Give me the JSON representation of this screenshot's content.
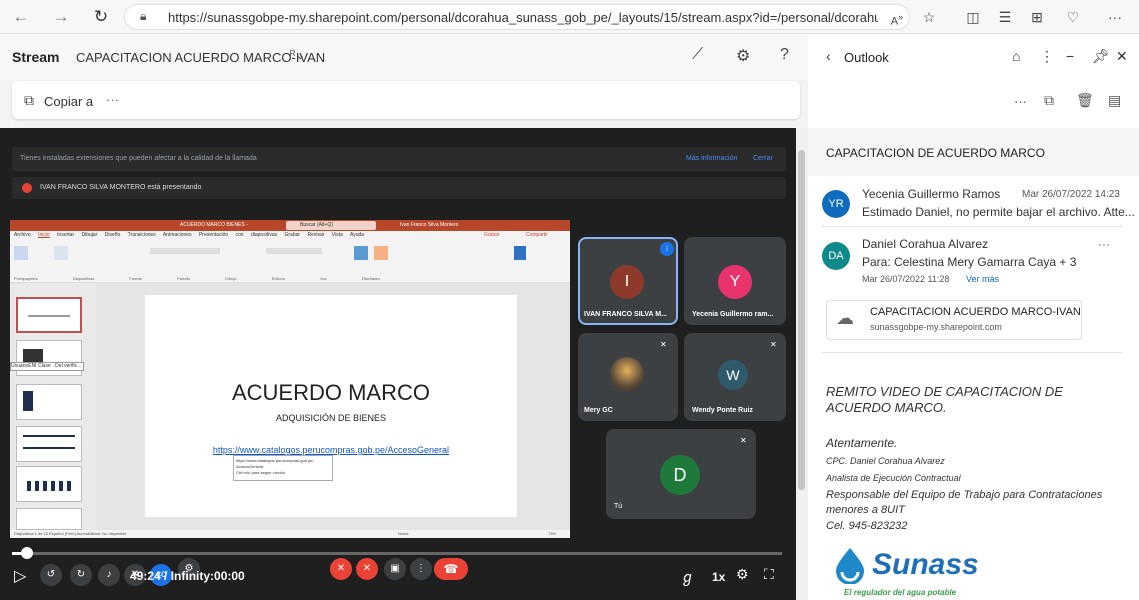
{
  "browser": {
    "url": "https://sunassgobpe-my.sharepoint.com/personal/dcorahua_sunass_gob_pe/_layouts/15/stream.aspx?id=/personal/dcorahua_suna..."
  },
  "stream": {
    "app": "Stream",
    "title": "CAPACITACION ACUERDO MARCO-IVAN",
    "copy_label": "Copiar a",
    "more": "···"
  },
  "meet": {
    "banner1": "Tienes instaladas extensiones que pueden afectar a la calidad de la llamada",
    "banner1_link": "Más información",
    "banner1_close": "Cerrar",
    "banner2": "IVAN FRANCO SILVA MONTERO está presentando",
    "ppt_title": "ACUERDO MARCO BIENES -",
    "ppt_search": "Buscar (Alt+Q)",
    "ppt_user": "Ivan Franco Silva Montero",
    "ppt_tabs": [
      "Archivo",
      "Inicio",
      "Insertar",
      "Dibujar",
      "Diseño",
      "Transiciones",
      "Animaciones",
      "Presentación con diapositivas",
      "Grabar",
      "Revisar",
      "Vista",
      "Ayuda"
    ],
    "ppt_groups": [
      "Portapapeles",
      "Diapositivas",
      "Fuente",
      "Párrafo",
      "Dibujo",
      "Edición",
      "Voz",
      "Diseñador"
    ],
    "ppt_grabar": "Grabar",
    "ppt_compartir": "Compartir",
    "slide_title": "ACUERDO MARCO",
    "slide_subtitle": "ADQUISICIÓN DE BIENES",
    "slide_link": "https://www.catalogos.perucompras.gob.pe/AccesoGeneral",
    "tooltip": [
      "https://www.catalogos.perucompras.gob.pe/",
      "AccesoGeneral",
      "Ctrl+clic para seguir vínculo"
    ],
    "thumb_tip": "UsuarioENI Clase · Del verific...",
    "status_left": "Diapositiva 1 de 12   Español (Perú)   Accesibilidad: No disponible",
    "status_right": "Notas",
    "zoom": "73%",
    "participants": [
      {
        "initial": "I",
        "name": "IVAN FRANCO SILVA M...",
        "color": "#8d3a2b"
      },
      {
        "initial": "Y",
        "name": "Yecenia Guillermo ram...",
        "color": "#e8336d"
      },
      {
        "initial": "",
        "name": "Mery GC",
        "color": "#5a4a3a"
      },
      {
        "initial": "W",
        "name": "Wendy Ponte Ruiz",
        "color": "#2e5a6b"
      },
      {
        "initial": "D",
        "name": "Tú",
        "color": "#1e7a3a"
      }
    ],
    "time": "49:24 / Infinity:00:00",
    "speed": "1x",
    "progress": 0.02
  },
  "outlook": {
    "title": "Outlook",
    "subject": "CAPACITACION DE ACUERDO MARCO",
    "msg1": {
      "initials": "YR",
      "sender": "Yecenia Guillermo Ramos",
      "date": "Mar 26/07/2022 14:23",
      "preview": "Estimado Daniel, no permite bajar el archivo. Atte..."
    },
    "msg2": {
      "initials": "DA",
      "sender": "Daniel Corahua Alvarez",
      "to": "Para: Celestina Mery Gamarra Caya  + 3",
      "date": "Mar 26/07/2022 11:28",
      "ver": "Ver más"
    },
    "attach": {
      "name": "CAPACITACION ACUERDO MARCO-IVAN",
      "site": "sunassgobpe-my.sharepoint.com"
    },
    "body": "REMITO VIDEO DE CAPACITACION DE ACUERDO MARCO.",
    "signature": [
      "Atentamente.",
      "CPC. Daniel Corahua Alvarez",
      "Analista de Ejecución Contractual",
      "Responsable del Equipo de Trabajo para Contrataciones menores a 8UIT",
      "Cel. 945-823232"
    ],
    "logo": "Sunass",
    "logo_tag": "El regulador del agua potable"
  },
  "colors": {
    "accent": "#1a73e8",
    "meetred": "#ea4335",
    "outlook": "#0f6cbd"
  }
}
